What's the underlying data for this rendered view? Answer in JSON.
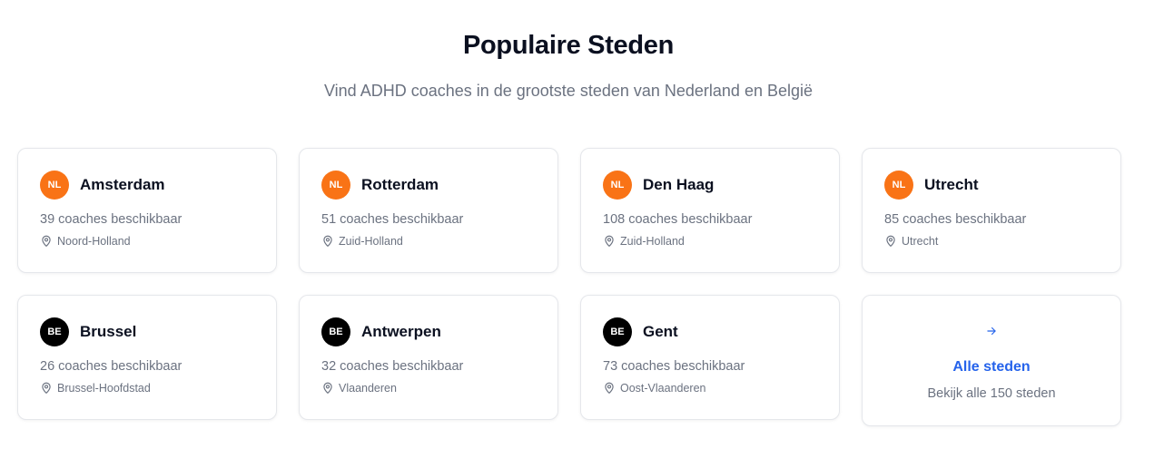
{
  "section": {
    "title": "Populaire Steden",
    "subtitle": "Vind ADHD coaches in de grootste steden van Nederland en België"
  },
  "cities": [
    {
      "flag": "NL",
      "name": "Amsterdam",
      "count": "39 coaches beschikbaar",
      "region": "Noord-Holland"
    },
    {
      "flag": "NL",
      "name": "Rotterdam",
      "count": "51 coaches beschikbaar",
      "region": "Zuid-Holland"
    },
    {
      "flag": "NL",
      "name": "Den Haag",
      "count": "108 coaches beschikbaar",
      "region": "Zuid-Holland"
    },
    {
      "flag": "NL",
      "name": "Utrecht",
      "count": "85 coaches beschikbaar",
      "region": "Utrecht"
    },
    {
      "flag": "BE",
      "name": "Brussel",
      "count": "26 coaches beschikbaar",
      "region": "Brussel-Hoofdstad"
    },
    {
      "flag": "BE",
      "name": "Antwerpen",
      "count": "32 coaches beschikbaar",
      "region": "Vlaanderen"
    },
    {
      "flag": "BE",
      "name": "Gent",
      "count": "73 coaches beschikbaar",
      "region": "Oost-Vlaanderen"
    }
  ],
  "all_cities": {
    "title": "Alle steden",
    "subtitle": "Bekijk alle 150 steden",
    "icon": "arrow-right-icon"
  },
  "colors": {
    "nl_badge": "#f97316",
    "be_badge": "#000000",
    "link": "#2563eb"
  }
}
